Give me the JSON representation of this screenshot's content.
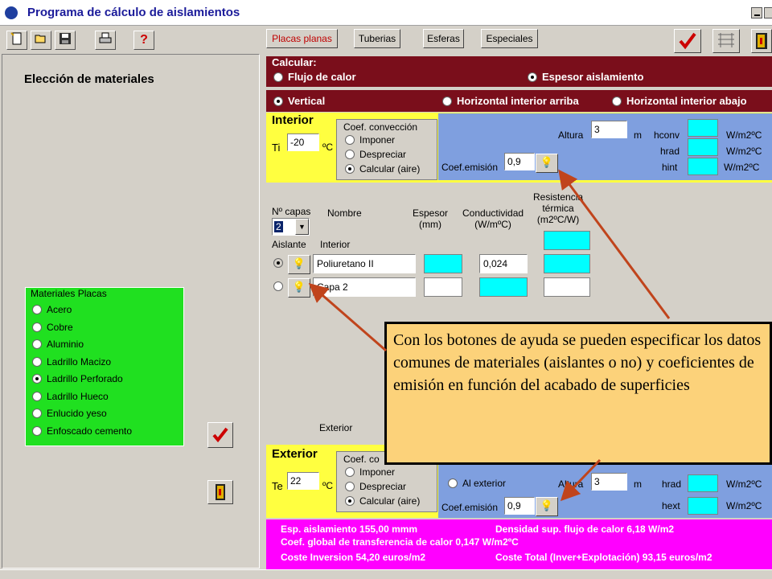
{
  "window": {
    "title": "Programa de cálculo de aislamientos"
  },
  "toolbar": {
    "icons": [
      "new-icon",
      "open-icon",
      "save-icon",
      "print-icon",
      "help-icon"
    ],
    "help_label": "?"
  },
  "tabs": [
    "Placas planas",
    "Tuberias",
    "Esferas",
    "Especiales"
  ],
  "left": {
    "heading": "Elección de materiales",
    "materials_title": "Materiales Placas",
    "materials": [
      "Acero",
      "Cobre",
      "Aluminio",
      "Ladrillo Macizo",
      "Ladrillo Perforado",
      "Ladrillo Hueco",
      "Enlucido yeso",
      "Enfoscado cemento"
    ],
    "selected_index": 4
  },
  "calc": {
    "title": "Calcular:",
    "opt1": "Flujo de calor",
    "opt2": "Espesor aislamiento",
    "selected": "Espesor aislamiento"
  },
  "orient": {
    "opt1": "Vertical",
    "opt2": "Horizontal interior arriba",
    "opt3": "Horizontal interior abajo",
    "selected": "Vertical"
  },
  "interior": {
    "title": "Interior",
    "ti_label": "Ti",
    "ti_value": "-20",
    "unit": "ºC",
    "coef_title": "Coef. convección",
    "coef_opts": [
      "Imponer",
      "Despreciar",
      "Calcular (aire)"
    ],
    "coef_selected": 2,
    "altura_label": "Altura",
    "altura_value": "3",
    "altura_unit": "m",
    "hconv": "hconv",
    "hrad": "hrad",
    "hint": "hint",
    "hunit": "W/m2ºC",
    "emision_label": "Coef.emisión",
    "emision_value": "0,9"
  },
  "layers": {
    "ncapas_label": "Nº capas",
    "ncapas_value": "2",
    "nombre": "Nombre",
    "espesor": "Espesor\n(mm)",
    "conductividad": "Conductividad\n(W/mºC)",
    "resistencia": "Resistencia\ntérmica\n(m2ºC/W)",
    "aislante": "Aislante",
    "interior": "Interior",
    "exterior": "Exterior",
    "rows": [
      {
        "name": "Poliuretano II",
        "espesor": "",
        "cond": "0,024",
        "checked": true
      },
      {
        "name": "Capa 2",
        "espesor": "",
        "cond": "",
        "checked": false
      }
    ]
  },
  "exterior": {
    "title": "Exterior",
    "te_label": "Te",
    "te_value": "22",
    "unit": "ºC",
    "coef_title": "Coef. co",
    "coef_opts": [
      "Imponer",
      "Despreciar",
      "Calcular (aire)"
    ],
    "coef_selected": 2,
    "al_exterior": "Al exterior",
    "altura_label": "Altura",
    "altura_value": "3",
    "altura_unit": "m",
    "hrad": "hrad",
    "hext": "hext",
    "hunit": "W/m2ºC",
    "emision_label": "Coef.emisión",
    "emision_value": "0,9"
  },
  "results": {
    "l1a": "Esp. aislamiento 155,00 mmm",
    "l1b": "Densidad sup. flujo de calor 6,18 W/m2",
    "l2": "Coef. global de transferencia de calor 0,147 W/m2ºC",
    "l3a": "Coste Inversion 54,20 euros/m2",
    "l3b": "Coste Total (Inver+Explotación) 93,15 euros/m2"
  },
  "callout": "Con los botones de ayuda se pueden especificar los datos comunes de materiales (aislantes o no) y coeficientes de emisión en función del acabado de superficies",
  "colors": {
    "maroon": "#7a0e1b",
    "yellow": "#ffff40",
    "green": "#20e020",
    "blue": "#7f9fdf",
    "magenta": "#ff00ff",
    "callout": "#fcd27a",
    "arrow": "#c0441c"
  }
}
